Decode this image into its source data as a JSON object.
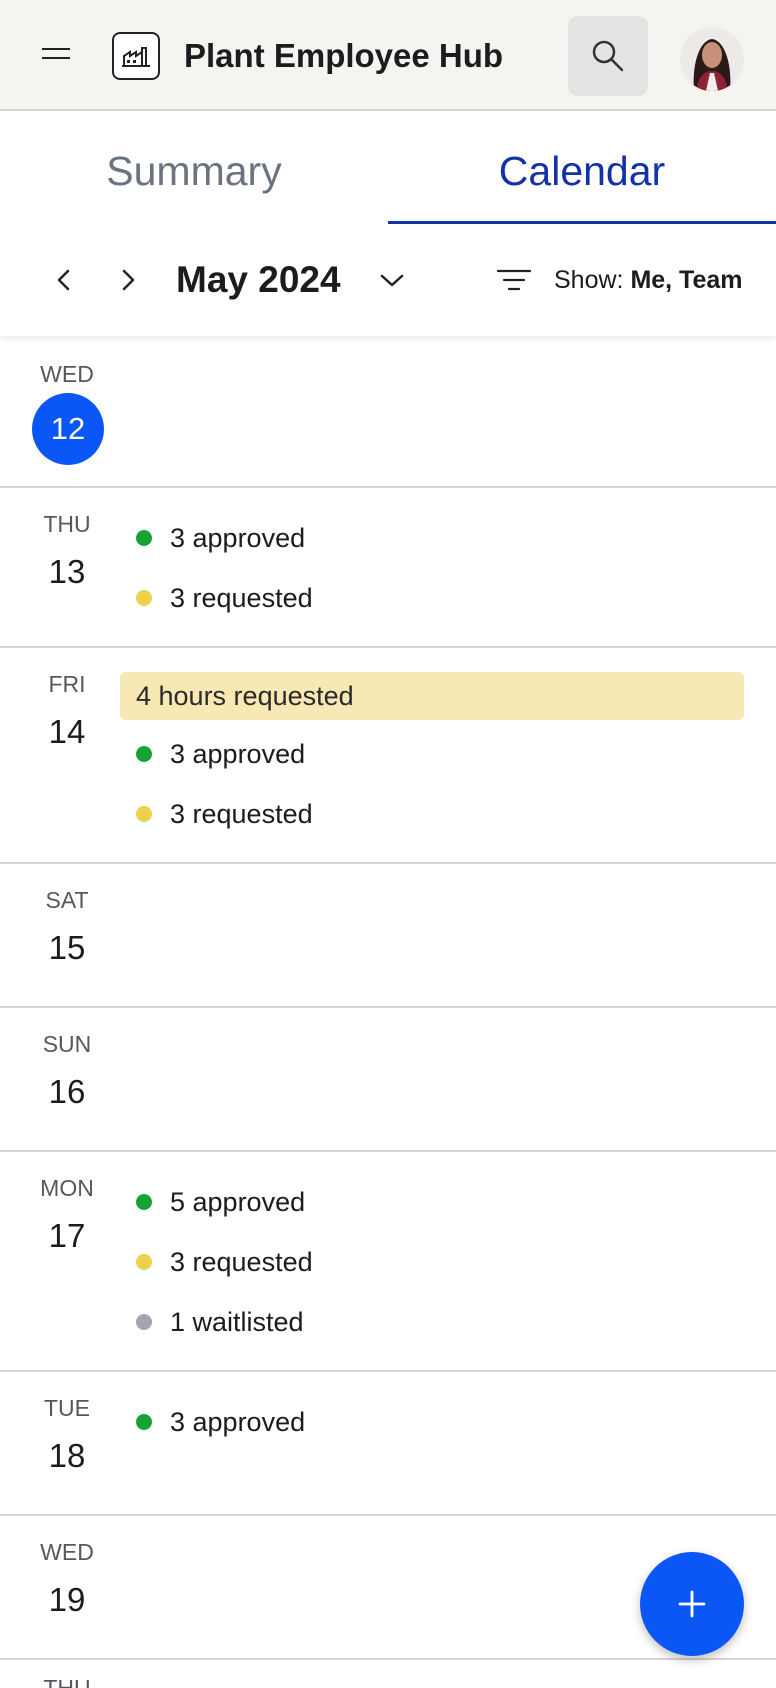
{
  "header": {
    "title": "Plant Employee Hub",
    "menu_icon": "hamburger-menu-icon",
    "logo_icon": "factory-icon",
    "search_icon": "search-icon",
    "avatar": "user-avatar"
  },
  "tabs": [
    {
      "label": "Summary",
      "active": false
    },
    {
      "label": "Calendar",
      "active": true
    }
  ],
  "toolbar": {
    "month": "May 2024",
    "show_label": "Show:",
    "show_value": "Me, Team"
  },
  "days": [
    {
      "dow": "WED",
      "date": "12",
      "today": true,
      "events": []
    },
    {
      "dow": "THU",
      "date": "13",
      "events": [
        {
          "status": "approved",
          "label": "3 approved"
        },
        {
          "status": "requested",
          "label": "3 requested"
        }
      ]
    },
    {
      "dow": "FRI",
      "date": "14",
      "highlight": "4 hours requested",
      "events": [
        {
          "status": "approved",
          "label": "3 approved"
        },
        {
          "status": "requested",
          "label": "3 requested"
        }
      ]
    },
    {
      "dow": "SAT",
      "date": "15",
      "events": []
    },
    {
      "dow": "SUN",
      "date": "16",
      "events": []
    },
    {
      "dow": "MON",
      "date": "17",
      "events": [
        {
          "status": "approved",
          "label": "5 approved"
        },
        {
          "status": "requested",
          "label": "3 requested"
        },
        {
          "status": "waitlisted",
          "label": "1 waitlisted"
        }
      ]
    },
    {
      "dow": "TUE",
      "date": "18",
      "events": [
        {
          "status": "approved",
          "label": "3 approved"
        }
      ]
    },
    {
      "dow": "WED",
      "date": "19",
      "events": []
    },
    {
      "dow": "THU",
      "date": "",
      "events": []
    }
  ],
  "colors": {
    "accent": "#0b57f5",
    "tab_active": "#1332a8",
    "approved": "#16a334",
    "requested": "#ecd24a",
    "waitlisted": "#a3a7ad",
    "highlight_bg": "#f8e9b4"
  }
}
